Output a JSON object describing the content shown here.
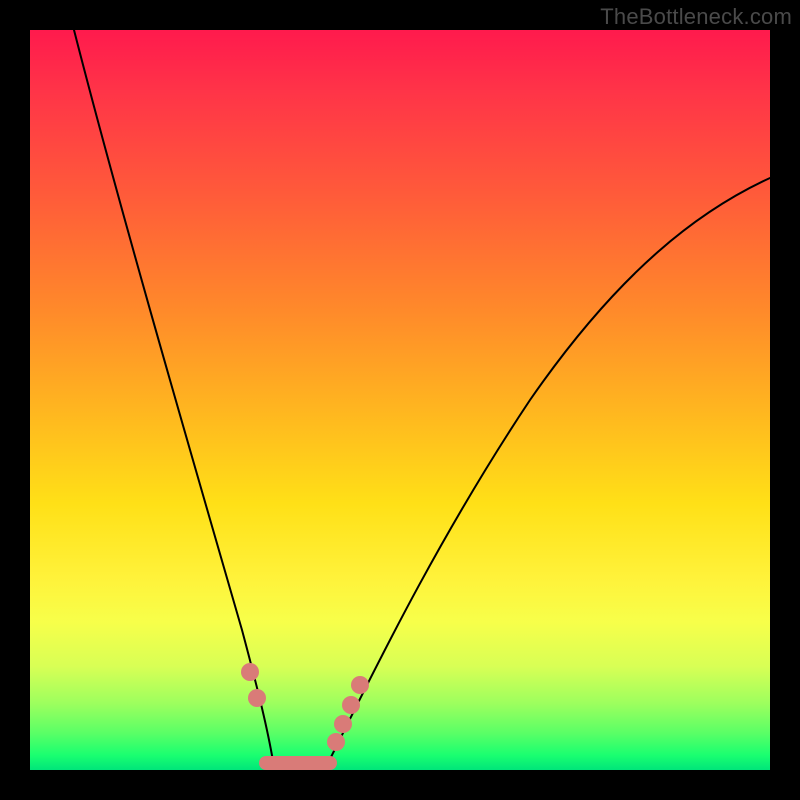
{
  "watermark": "TheBottleneck.com",
  "chart_data": {
    "type": "line",
    "title": "",
    "xlabel": "",
    "ylabel": "",
    "xlim": [
      0,
      100
    ],
    "ylim": [
      0,
      100
    ],
    "series": [
      {
        "name": "left-curve",
        "x": [
          6,
          10,
          14,
          18,
          22,
          25,
          27,
          29,
          30.5,
          32,
          33
        ],
        "y": [
          100,
          88,
          75,
          60,
          43,
          28,
          18,
          10,
          5,
          2,
          0
        ]
      },
      {
        "name": "right-curve",
        "x": [
          40,
          42,
          45,
          50,
          57,
          66,
          76,
          88,
          100
        ],
        "y": [
          0,
          3,
          8,
          17,
          30,
          45,
          58,
          70,
          80
        ]
      },
      {
        "name": "valley-floor",
        "x": [
          33,
          40
        ],
        "y": [
          0,
          0
        ]
      }
    ],
    "annotations": [
      {
        "name": "bead-left-upper",
        "on": "left-curve",
        "t": 0.86
      },
      {
        "name": "bead-left-lower",
        "on": "left-curve",
        "t": 0.9
      },
      {
        "name": "bead-right-a",
        "on": "right-curve",
        "t": 0.05
      },
      {
        "name": "bead-right-b",
        "on": "right-curve",
        "t": 0.1
      },
      {
        "name": "bead-right-c",
        "on": "right-curve",
        "t": 0.15
      },
      {
        "name": "bead-right-d",
        "on": "right-curve",
        "t": 0.2
      }
    ],
    "gradient_stops": [
      {
        "pos": 0,
        "color": "#ff1a4d"
      },
      {
        "pos": 50,
        "color": "#ffd21f"
      },
      {
        "pos": 80,
        "color": "#f7ff4a"
      },
      {
        "pos": 100,
        "color": "#00e57a"
      }
    ]
  }
}
